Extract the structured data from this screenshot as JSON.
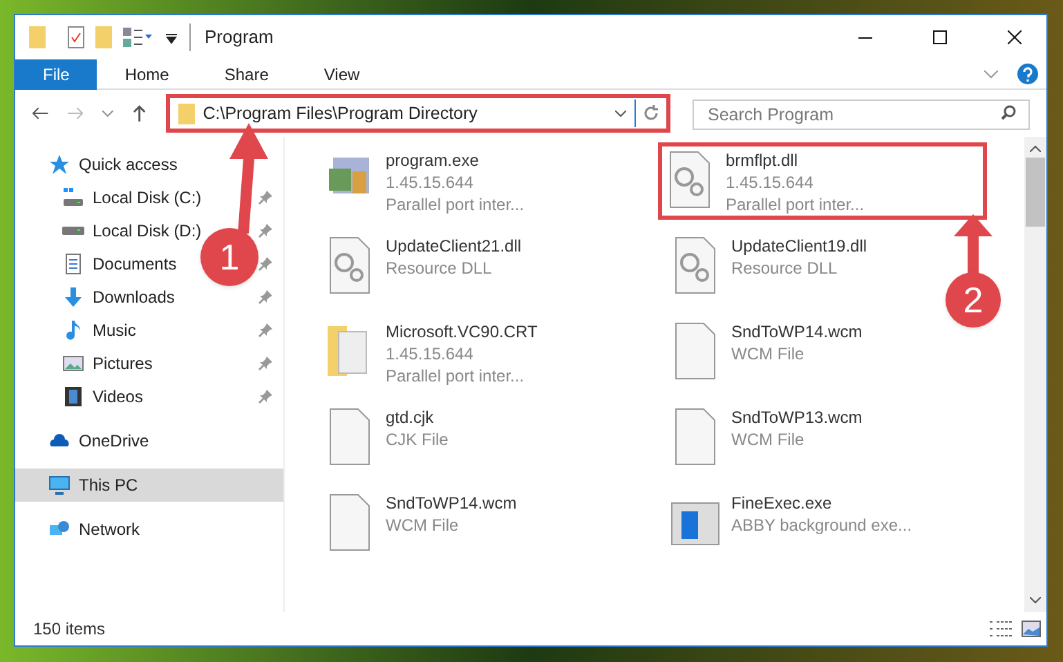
{
  "window": {
    "title": "Program"
  },
  "ribbon": {
    "tabs": [
      {
        "label": "File",
        "selected": true
      },
      {
        "label": "Home",
        "selected": false
      },
      {
        "label": "Share",
        "selected": false
      },
      {
        "label": "View",
        "selected": false
      }
    ]
  },
  "address_bar": {
    "path": "C:\\Program Files\\Program Directory",
    "highlighted": true
  },
  "search": {
    "placeholder": "Search Program"
  },
  "sidebar": {
    "items": [
      {
        "label": "Quick access",
        "pinned": false,
        "selected": false,
        "children": [
          {
            "label": "Local Disk (C:)",
            "pinned": true,
            "selected": false
          },
          {
            "label": "Local Disk (D:)",
            "pinned": true,
            "selected": false
          },
          {
            "label": "Documents",
            "pinned": true,
            "selected": false
          },
          {
            "label": "Downloads",
            "pinned": true,
            "selected": false
          },
          {
            "label": "Music",
            "pinned": true,
            "selected": false
          },
          {
            "label": "Pictures",
            "pinned": true,
            "selected": false
          },
          {
            "label": "Videos",
            "pinned": true,
            "selected": false
          }
        ]
      },
      {
        "label": "OneDrive",
        "pinned": false,
        "selected": false
      },
      {
        "label": "This PC",
        "pinned": false,
        "selected": true
      },
      {
        "label": "Network",
        "pinned": false,
        "selected": false
      }
    ]
  },
  "files": [
    {
      "name": "program.exe",
      "kind": "exe",
      "lines": [
        "1.45.15.644",
        "Parallel port inter..."
      ],
      "highlighted": false
    },
    {
      "name": "brmflpt.dll",
      "kind": "dll",
      "lines": [
        "1.45.15.644",
        "Parallel port inter..."
      ],
      "highlighted": true
    },
    {
      "name": "UpdateClient21.dll",
      "kind": "dll",
      "lines": [
        "Resource DLL"
      ],
      "highlighted": false
    },
    {
      "name": "UpdateClient19.dll",
      "kind": "dll",
      "lines": [
        "Resource DLL"
      ],
      "highlighted": false
    },
    {
      "name": "Microsoft.VC90.CRT",
      "kind": "folder",
      "lines": [
        "1.45.15.644",
        "Parallel port inter..."
      ],
      "highlighted": false
    },
    {
      "name": "SndToWP14.wcm",
      "kind": "file",
      "lines": [
        "WCM File"
      ],
      "highlighted": false
    },
    {
      "name": "gtd.cjk",
      "kind": "file",
      "lines": [
        "CJK File"
      ],
      "highlighted": false
    },
    {
      "name": "SndToWP13.wcm",
      "kind": "file",
      "lines": [
        "WCM File"
      ],
      "highlighted": false
    },
    {
      "name": "SndToWP14.wcm",
      "kind": "file",
      "lines": [
        "WCM File"
      ],
      "highlighted": false
    },
    {
      "name": "FineExec.exe",
      "kind": "app",
      "lines": [
        "ABBY background exe..."
      ],
      "highlighted": false
    }
  ],
  "callouts": [
    {
      "number": "1"
    },
    {
      "number": "2"
    }
  ],
  "status_bar": {
    "count": "150 items"
  }
}
